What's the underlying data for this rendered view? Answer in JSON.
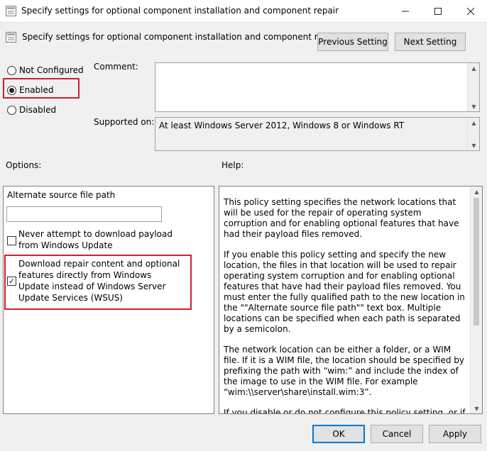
{
  "window": {
    "title": "Specify settings for optional component installation and component repair",
    "minimize_icon": "minimize-icon",
    "maximize_icon": "maximize-icon",
    "close_icon": "close-icon"
  },
  "header": {
    "policy_title": "Specify settings for optional component installation and component repair",
    "previous_label": "Previous Setting",
    "next_label": "Next Setting"
  },
  "state": {
    "options": [
      {
        "label": "Not Configured",
        "selected": false
      },
      {
        "label": "Enabled",
        "selected": true
      },
      {
        "label": "Disabled",
        "selected": false
      }
    ]
  },
  "comment": {
    "label": "Comment:",
    "value": ""
  },
  "supported": {
    "label": "Supported on:",
    "value": "At least Windows Server 2012, Windows 8 or Windows RT"
  },
  "options_section": {
    "label": "Options:",
    "alt_path_label": "Alternate source file path",
    "alt_path_value": "",
    "never_download_label": "Never attempt to download payload from Windows Update",
    "never_download_checked": false,
    "download_wu_label": "Download repair content and optional features directly from Windows Update instead of Windows Server Update Services (WSUS)",
    "download_wu_checked": true
  },
  "help": {
    "label": "Help:",
    "p1": "This policy setting specifies the network locations that will be used for the repair of operating system corruption and for enabling optional features that have had their payload files removed.",
    "p2": "If you enable this policy setting and specify the new location, the files in that location will be used to repair operating system corruption and for enabling optional features that have had their payload files removed. You must enter the fully qualified path to the new location in the \"\"Alternate source file path\"\" text box. Multiple locations can be specified when each path is separated by a semicolon.",
    "p3": "The network location can be either a folder, or a WIM file. If it is a WIM file, the location should be specified by prefixing the path with “wim:” and include the index of the image to use in the WIM file. For example “wim:\\\\server\\share\\install.wim:3”.",
    "p4": "If you disable or do not configure this policy setting, or if the required files cannot be found at the locations specified in this"
  },
  "footer": {
    "ok_label": "OK",
    "cancel_label": "Cancel",
    "apply_label": "Apply"
  },
  "colors": {
    "highlight_box": "#d0202a",
    "focus_border": "#0078d7"
  }
}
